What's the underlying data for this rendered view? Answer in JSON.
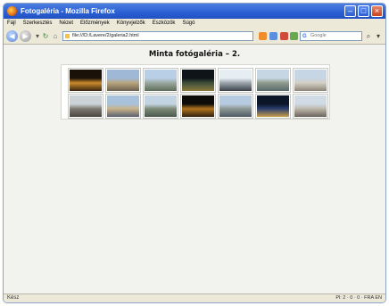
{
  "window": {
    "title": "Fotogaléria - Mozilla Firefox"
  },
  "menubar": [
    "Fájl",
    "Szerkesztés",
    "Nézet",
    "Előzmények",
    "Könyvjelzők",
    "Eszközök",
    "Súgó"
  ],
  "navbar": {
    "url": "file:///D:/Lavere/2/galeria2.html",
    "search_placeholder": "Google"
  },
  "page": {
    "heading": "Minta fotógaléria – 2.",
    "thumbnails": [
      {
        "name": "thumb-night-bridge-1",
        "colors": [
          "#1a1208",
          "#c98a2c",
          "#3b2410"
        ]
      },
      {
        "name": "thumb-parliament-day",
        "colors": [
          "#9fb8d6",
          "#b8a57e",
          "#6e6250"
        ]
      },
      {
        "name": "thumb-citadel-view",
        "colors": [
          "#b9cfe6",
          "#9aa7a0",
          "#5f6d5a"
        ]
      },
      {
        "name": "thumb-night-monument",
        "colors": [
          "#0f1418",
          "#3f4e3a",
          "#8a7a3a"
        ]
      },
      {
        "name": "thumb-statue-sky",
        "colors": [
          "#e6edf3",
          "#9aa4ac",
          "#3c4148"
        ]
      },
      {
        "name": "thumb-river-panorama",
        "colors": [
          "#c6d6e2",
          "#8e9a8c",
          "#5a6a6c"
        ]
      },
      {
        "name": "thumb-museum-columns",
        "colors": [
          "#c7d6e4",
          "#d4cfc4",
          "#8c8478"
        ]
      },
      {
        "name": "thumb-street-buildings",
        "colors": [
          "#cbd2d8",
          "#7e7a72",
          "#4a4640"
        ]
      },
      {
        "name": "thumb-parliament-river",
        "colors": [
          "#a9c2dc",
          "#c9b48a",
          "#5a6070"
        ]
      },
      {
        "name": "thumb-bridge-day",
        "colors": [
          "#c2d4e2",
          "#7e8a78",
          "#4a5a4c"
        ]
      },
      {
        "name": "thumb-night-bridge-2",
        "colors": [
          "#0e0c08",
          "#b0741e",
          "#302010"
        ]
      },
      {
        "name": "thumb-danube-cityscape",
        "colors": [
          "#b7cbe0",
          "#8d9894",
          "#4c5a66"
        ]
      },
      {
        "name": "thumb-night-river",
        "colors": [
          "#0b1628",
          "#2a3e6e",
          "#c9a048"
        ]
      },
      {
        "name": "thumb-museum-front",
        "colors": [
          "#d0dbe6",
          "#bdb7aa",
          "#6a655c"
        ]
      }
    ]
  },
  "statusbar": {
    "left": "Kész",
    "right": "Pl: 2 · 0 · 0 · FRA EN"
  }
}
